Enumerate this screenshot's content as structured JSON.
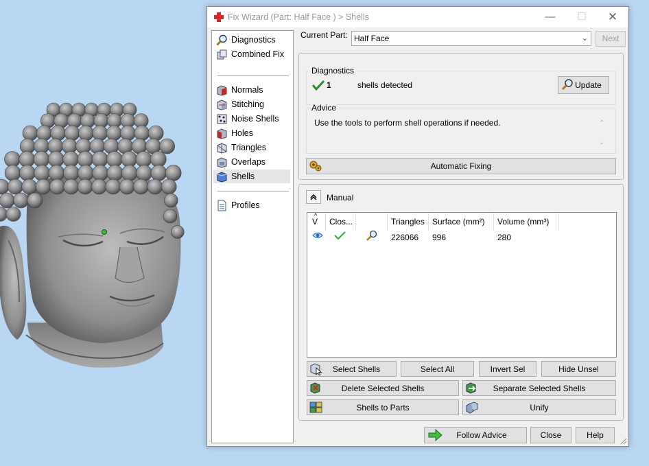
{
  "window": {
    "title": "Fix Wizard (Part: Half Face ) > Shells",
    "minimize": "—",
    "maximize": "☐",
    "close": "✕"
  },
  "nav": {
    "items": [
      {
        "label": "Diagnostics",
        "icon": "magnifier-icon"
      },
      {
        "label": "Combined Fix",
        "icon": "cubes-icon"
      },
      {
        "label": "Normals",
        "icon": "normals-cube-icon"
      },
      {
        "label": "Stitching",
        "icon": "stitching-cube-icon"
      },
      {
        "label": "Noise Shells",
        "icon": "noise-shells-icon"
      },
      {
        "label": "Holes",
        "icon": "holes-cube-icon"
      },
      {
        "label": "Triangles",
        "icon": "triangles-icon"
      },
      {
        "label": "Overlaps",
        "icon": "overlaps-icon"
      },
      {
        "label": "Shells",
        "icon": "shells-cube-icon"
      },
      {
        "label": "Profiles",
        "icon": "document-icon"
      }
    ],
    "selected": "Shells"
  },
  "current_part": {
    "label": "Current Part:",
    "value": "Half Face",
    "next": "Next"
  },
  "diagnostics": {
    "title": "Diagnostics",
    "count": "1",
    "message": "shells detected",
    "update": "Update"
  },
  "advice": {
    "title": "Advice",
    "text": "Use the tools to perform shell operations if needed."
  },
  "automatic_fixing": "Automatic Fixing",
  "manual": {
    "title": "Manual",
    "table": {
      "columns": [
        "V",
        "Clos...",
        "",
        "Triangles",
        "Surface (mm²)",
        "Volume (mm³)"
      ],
      "rows": [
        {
          "visible_icon": "eye-icon",
          "closed_icon": "checkmark-icon",
          "zoom_icon": "zoom-icon",
          "triangles": "226066",
          "surface": "996",
          "volume": "280"
        }
      ]
    },
    "buttons": {
      "select_shells": "Select Shells",
      "select_all": "Select All",
      "invert_sel": "Invert Sel",
      "hide_unsel": "Hide Unsel",
      "delete_selected": "Delete Selected Shells",
      "separate_selected": "Separate Selected Shells",
      "shells_to_parts": "Shells to Parts",
      "unify": "Unify"
    }
  },
  "footer": {
    "follow_advice": "Follow Advice",
    "close": "Close",
    "help": "Help"
  },
  "colors": {
    "desktop": "#b9d6f2",
    "model_gray": "#8c8c8c",
    "check_green": "#2e8b2e",
    "brand_red": "#d9272e"
  }
}
